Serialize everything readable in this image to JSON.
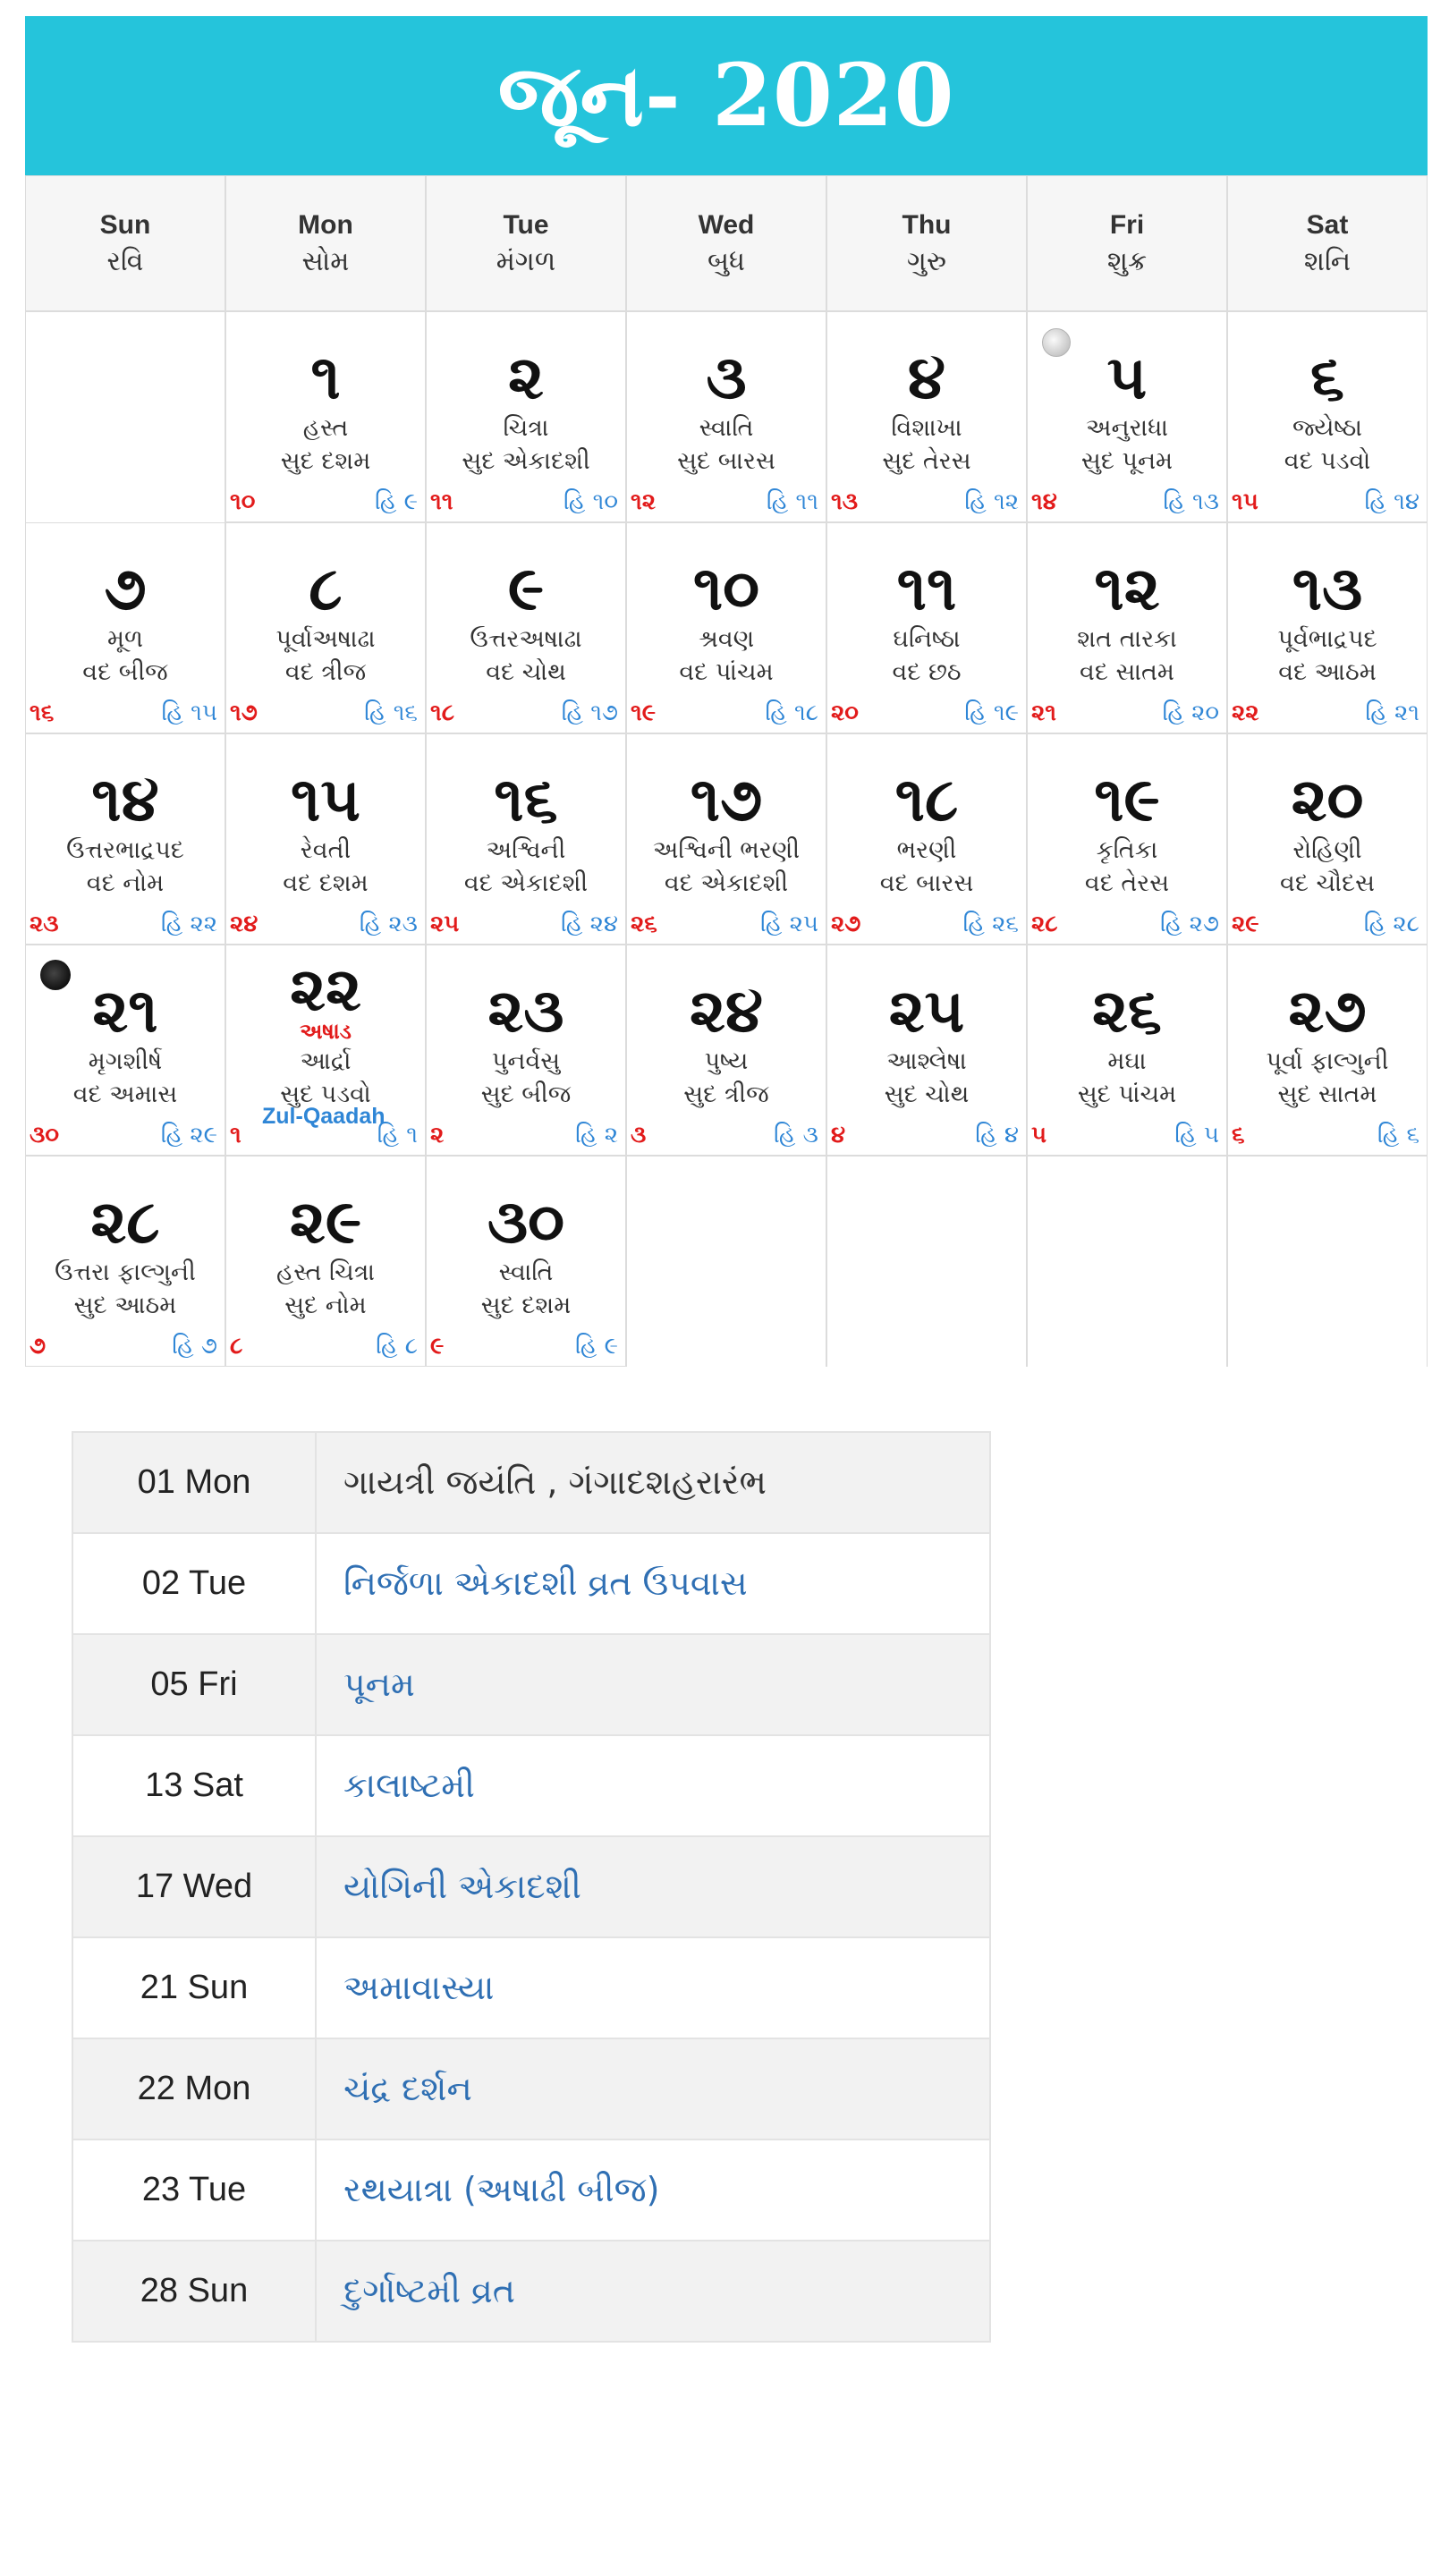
{
  "title": "જૂન- 2020",
  "weekdays": [
    {
      "en": "Sun",
      "gu": "રવિ"
    },
    {
      "en": "Mon",
      "gu": "સોમ"
    },
    {
      "en": "Tue",
      "gu": "મંગળ"
    },
    {
      "en": "Wed",
      "gu": "બુધ"
    },
    {
      "en": "Thu",
      "gu": "ગુરુ"
    },
    {
      "en": "Fri",
      "gu": "શુક્ર"
    },
    {
      "en": "Sat",
      "gu": "શનિ"
    }
  ],
  "days": [
    {
      "num": "૧",
      "nak": "હસ્ત",
      "tithi": "સુદ દશમ",
      "h": "૧૦",
      "hijri": "હિ ૯"
    },
    {
      "num": "૨",
      "nak": "ચિત્રા",
      "tithi": "સુદ એકાદશી",
      "h": "૧૧",
      "hijri": "હિ ૧૦"
    },
    {
      "num": "૩",
      "nak": "સ્વાતિ",
      "tithi": "સુદ બારસ",
      "h": "૧૨",
      "hijri": "હિ ૧૧"
    },
    {
      "num": "૪",
      "nak": "વિશાખા",
      "tithi": "સુદ તેરસ",
      "h": "૧૩",
      "hijri": "હિ ૧૨"
    },
    {
      "num": "૫",
      "nak": "અનુરાધા",
      "tithi": "સુદ પૂનમ",
      "h": "૧૪",
      "hijri": "હિ ૧૩",
      "moon": "full"
    },
    {
      "num": "૬",
      "nak": "જ્યેષ્ઠા",
      "tithi": "વદ પડવો",
      "h": "૧૫",
      "hijri": "હિ ૧૪"
    },
    {
      "num": "૭",
      "nak": "મૂળ",
      "tithi": "વદ બીજ",
      "h": "૧૬",
      "hijri": "હિ ૧૫"
    },
    {
      "num": "૮",
      "nak": "પૂર્વાઅષાઢા",
      "tithi": "વદ ત્રીજ",
      "h": "૧૭",
      "hijri": "હિ ૧૬"
    },
    {
      "num": "૯",
      "nak": "ઉત્તરઅષાઢા",
      "tithi": "વદ ચોથ",
      "h": "૧૮",
      "hijri": "હિ ૧૭"
    },
    {
      "num": "૧૦",
      "nak": "શ્રવણ",
      "tithi": "વદ પાંચમ",
      "h": "૧૯",
      "hijri": "હિ ૧૮"
    },
    {
      "num": "૧૧",
      "nak": "ઘનિષ્ઠા",
      "tithi": "વદ છઠ",
      "h": "૨૦",
      "hijri": "હિ ૧૯"
    },
    {
      "num": "૧૨",
      "nak": "શત તારકા",
      "tithi": "વદ સાતમ",
      "h": "૨૧",
      "hijri": "હિ ૨૦"
    },
    {
      "num": "૧૩",
      "nak": "પૂર્વભાદ્રપદ",
      "tithi": "વદ આઠમ",
      "h": "૨૨",
      "hijri": "હિ ૨૧"
    },
    {
      "num": "૧૪",
      "nak": "ઉત્તરભાદ્રપદ",
      "tithi": "વદ નોમ",
      "h": "૨૩",
      "hijri": "હિ ૨૨"
    },
    {
      "num": "૧૫",
      "nak": "રેવતી",
      "tithi": "વદ દશમ",
      "h": "૨૪",
      "hijri": "હિ ૨૩"
    },
    {
      "num": "૧૬",
      "nak": "અશ્વિની",
      "tithi": "વદ એકાદશી",
      "h": "૨૫",
      "hijri": "હિ ૨૪"
    },
    {
      "num": "૧૭",
      "nak": "અશ્વિની ભરણી",
      "tithi": "વદ એકાદશી",
      "h": "૨૬",
      "hijri": "હિ ૨૫"
    },
    {
      "num": "૧૮",
      "nak": "ભરણી",
      "tithi": "વદ બારસ",
      "h": "૨૭",
      "hijri": "હિ ૨૬"
    },
    {
      "num": "૧૯",
      "nak": "કૃતિકા",
      "tithi": "વદ તેરસ",
      "h": "૨૮",
      "hijri": "હિ ૨૭"
    },
    {
      "num": "૨૦",
      "nak": "રોહિણી",
      "tithi": "વદ ચૌદસ",
      "h": "૨૯",
      "hijri": "હિ ૨૮"
    },
    {
      "num": "૨૧",
      "nak": "મૃગશીર્ષ",
      "tithi": "વદ અમાસ",
      "h": "૩૦",
      "hijri": "હિ ૨૯",
      "moon": "new"
    },
    {
      "num": "૨૨",
      "extra": "અષાડ",
      "nak": "આર્દ્રા",
      "tithi": "સુદ પડવો",
      "h": "૧",
      "hijri": "હિ ૧",
      "islamic": "Zul-Qaadah"
    },
    {
      "num": "૨૩",
      "nak": "પુનર્વસુ",
      "tithi": "સુદ બીજ",
      "h": "૨",
      "hijri": "હિ ૨"
    },
    {
      "num": "૨૪",
      "nak": "પુષ્ય",
      "tithi": "સુદ ત્રીજ",
      "h": "૩",
      "hijri": "હિ ૩"
    },
    {
      "num": "૨૫",
      "nak": "આશ્લેષા",
      "tithi": "સુદ ચોથ",
      "h": "૪",
      "hijri": "હિ ૪"
    },
    {
      "num": "૨૬",
      "nak": "મઘા",
      "tithi": "સુદ પાંચમ",
      "h": "૫",
      "hijri": "હિ ૫"
    },
    {
      "num": "૨૭",
      "nak": "પૂર્વા ફાલ્ગુની",
      "tithi": "સુદ સાતમ",
      "h": "૬",
      "hijri": "હિ ૬"
    },
    {
      "num": "૨૮",
      "nak": "ઉત્તરા ફાલ્ગુની",
      "tithi": "સુદ આઠમ",
      "h": "૭",
      "hijri": "હિ ૭"
    },
    {
      "num": "૨૯",
      "nak": "હસ્ત ચિત્રા",
      "tithi": "સુદ નોમ",
      "h": "૮",
      "hijri": "હિ ૮"
    },
    {
      "num": "૩૦",
      "nak": "સ્વાતિ",
      "tithi": "સુદ દશમ",
      "h": "૯",
      "hijri": "હિ ૯"
    }
  ],
  "events": [
    {
      "date": "01 Mon",
      "text": "ગાયત્રી જયંતિ , ગંગાદશહરારંભ",
      "link": false
    },
    {
      "date": "02 Tue",
      "text": "નિર્જળા એકાદશી વ્રત ઉપવાસ",
      "link": true
    },
    {
      "date": "05 Fri",
      "text": "પૂનમ",
      "link": true
    },
    {
      "date": "13 Sat",
      "text": "કાલાષ્ટમી",
      "link": true
    },
    {
      "date": "17 Wed",
      "text": "યોગિની એકાદશી",
      "link": true
    },
    {
      "date": "21 Sun",
      "text": "અમાવાસ્યા",
      "link": true
    },
    {
      "date": "22 Mon",
      "text": "ચંદ્ર દર્શન",
      "link": true
    },
    {
      "date": "23 Tue",
      "text": "રથયાત્રા (અષાઢી બીજ)",
      "link": true
    },
    {
      "date": "28 Sun",
      "text": "દુર્ગાષ્ટમી વ્રત",
      "link": true
    }
  ],
  "colors": {
    "header": "#25c4db",
    "hindu": "#e21b1b",
    "hijri": "#2f86d6",
    "event_link": "#2f6fb3"
  }
}
